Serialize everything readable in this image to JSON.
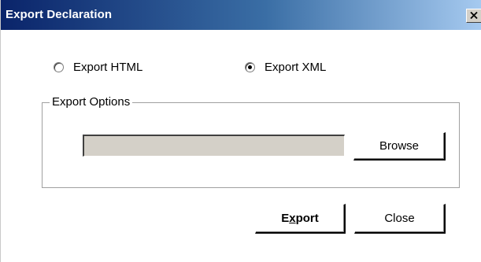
{
  "window": {
    "title": "Export Declaration",
    "close_glyph": "close-icon"
  },
  "format": {
    "options": [
      {
        "label": "Export HTML",
        "selected": false
      },
      {
        "label": "Export XML",
        "selected": true
      }
    ]
  },
  "export_options": {
    "legend": "Export Options",
    "path_value": "",
    "browse_label": "Browse"
  },
  "actions": {
    "export_label_pre": "E",
    "export_label_mnemonic": "x",
    "export_label_post": "port",
    "close_label": "Close"
  },
  "colors": {
    "title_start": "#0a246a",
    "title_end": "#a6caf0",
    "field_bg": "#d4d0c8"
  }
}
